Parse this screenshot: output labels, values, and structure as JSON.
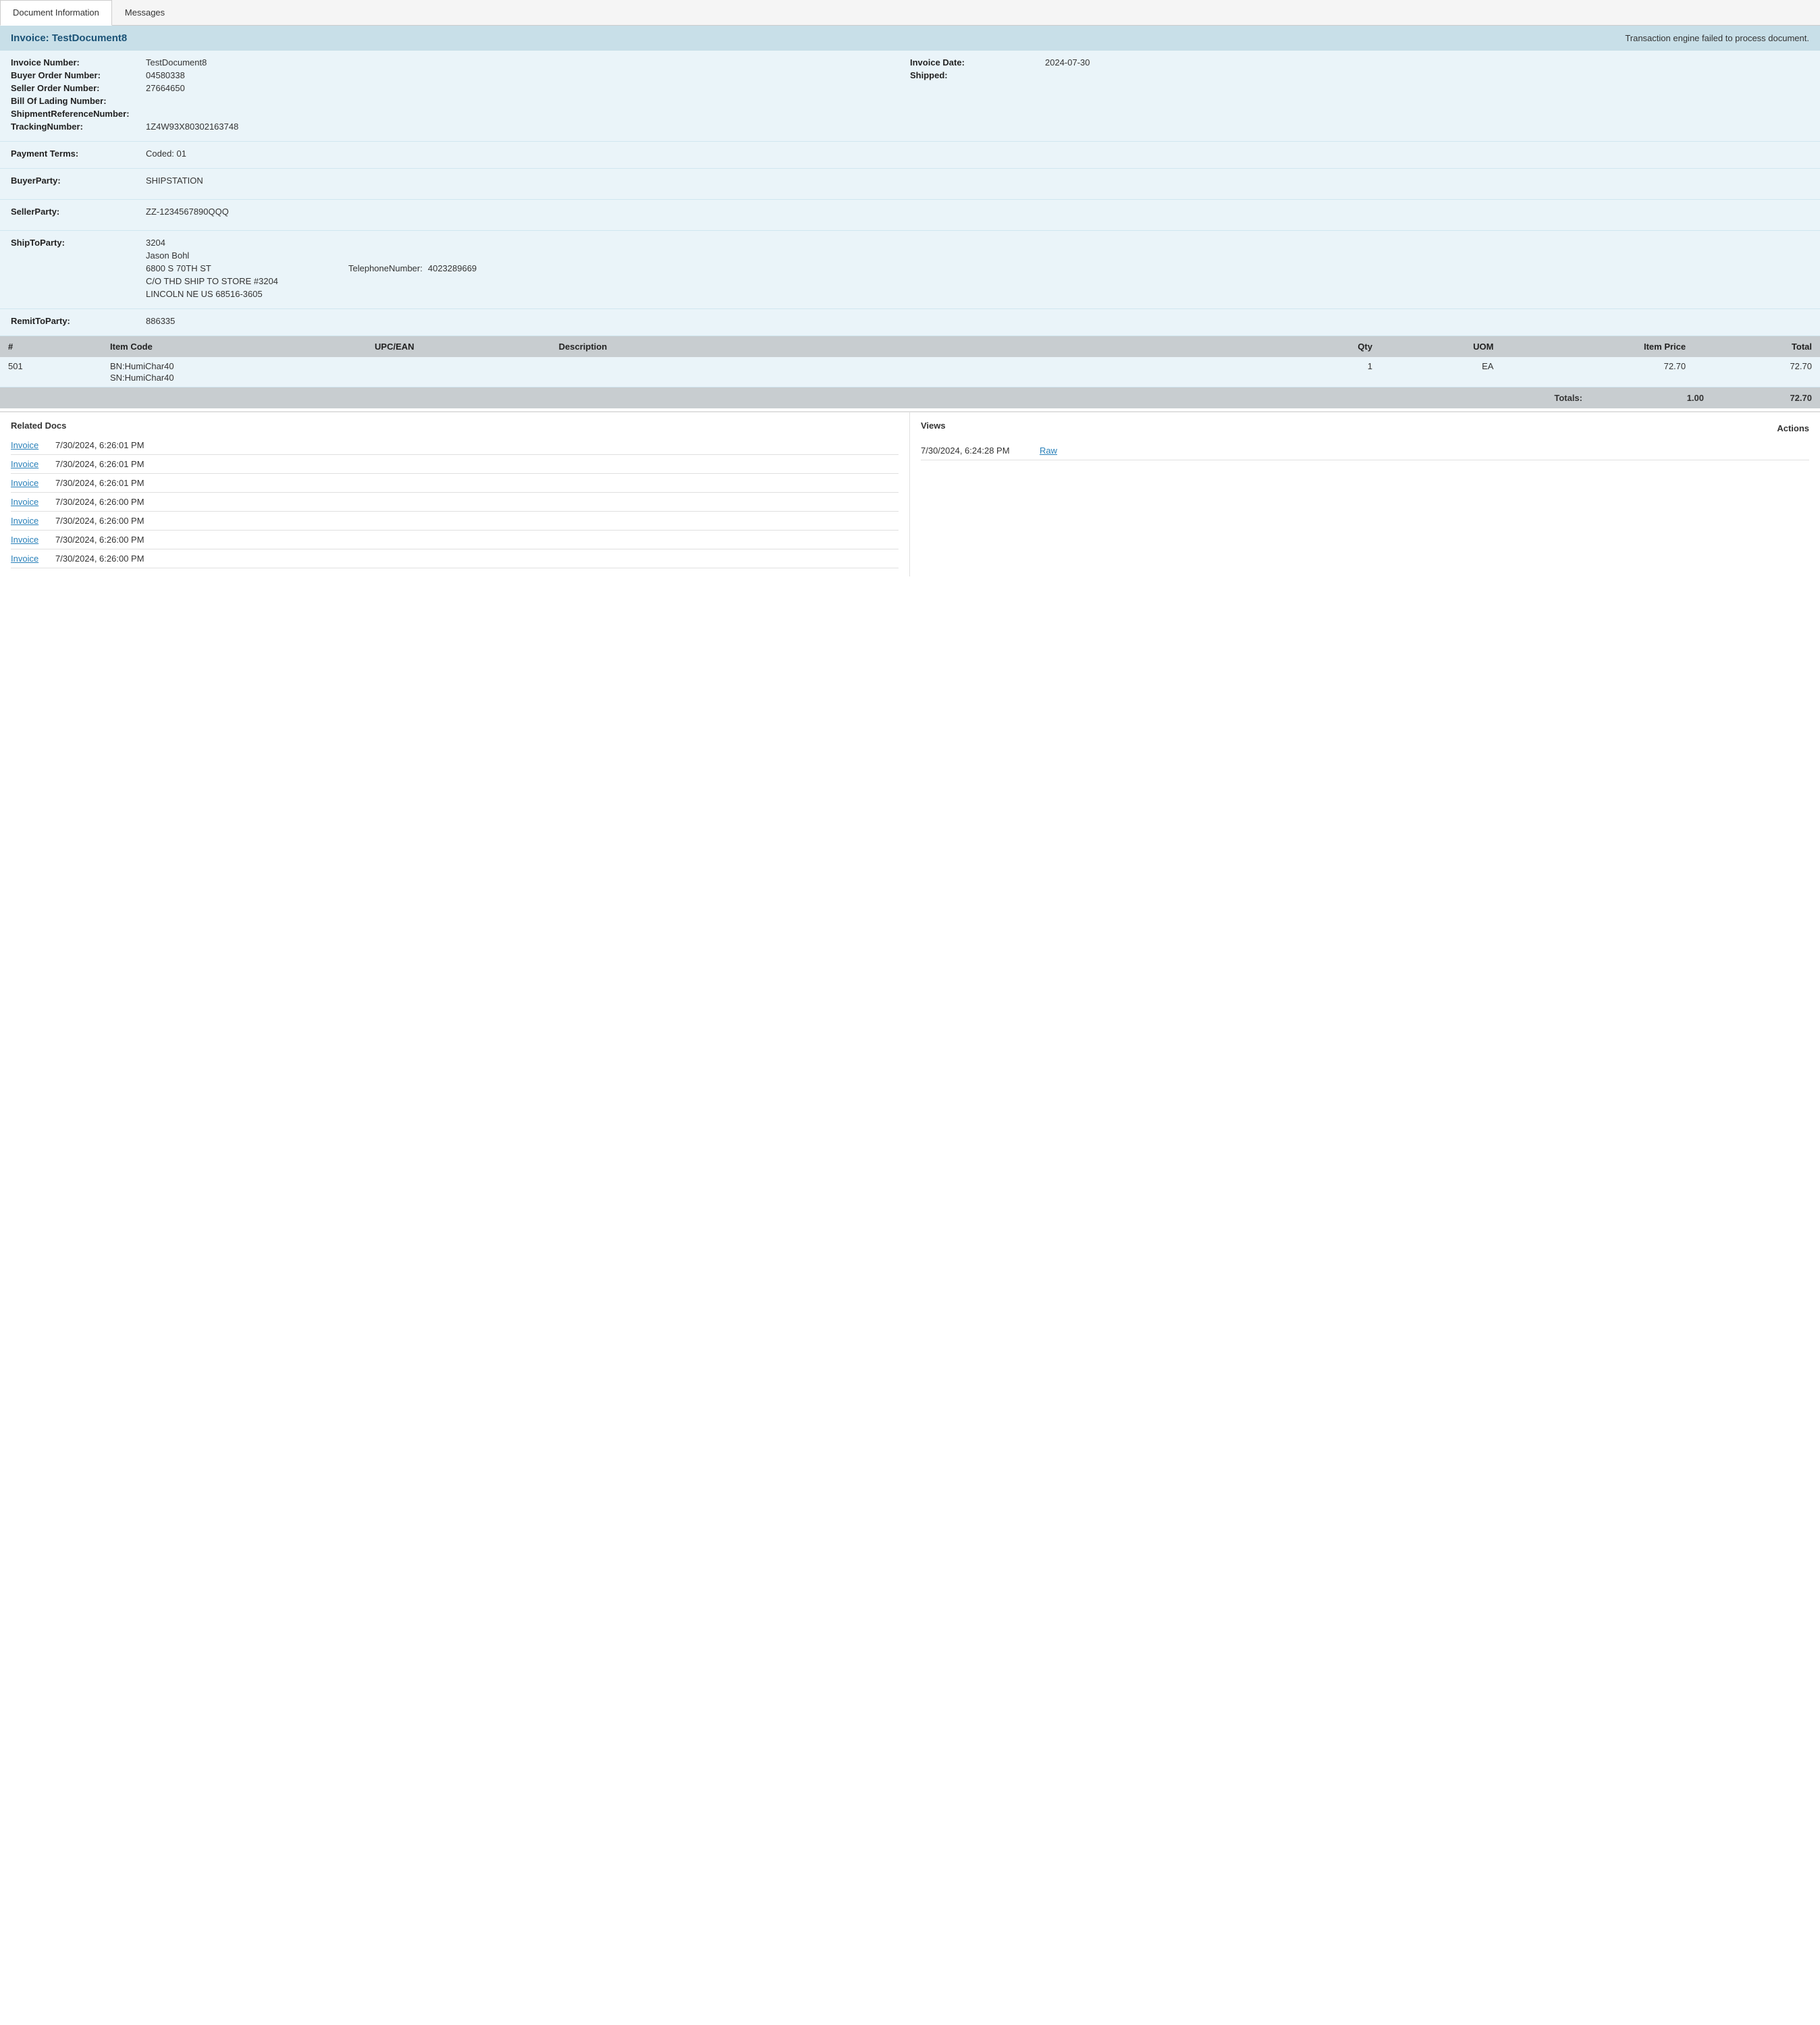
{
  "tabs": [
    {
      "id": "doc-info",
      "label": "Document Information",
      "active": true
    },
    {
      "id": "messages",
      "label": "Messages",
      "active": false
    }
  ],
  "banner": {
    "title": "Invoice: TestDocument8",
    "error": "Transaction engine failed to process document."
  },
  "fields": {
    "invoice_number_label": "Invoice Number:",
    "invoice_number_value": "TestDocument8",
    "invoice_date_label": "Invoice Date:",
    "invoice_date_value": "2024-07-30",
    "buyer_order_label": "Buyer Order Number:",
    "buyer_order_value": "04580338",
    "shipped_label": "Shipped:",
    "shipped_value": "",
    "seller_order_label": "Seller Order Number:",
    "seller_order_value": "27664650",
    "bill_of_lading_label": "Bill Of Lading Number:",
    "bill_of_lading_value": "",
    "shipment_ref_label": "ShipmentReferenceNumber:",
    "shipment_ref_value": "",
    "tracking_label": "TrackingNumber:",
    "tracking_value": "1Z4W93X80302163748",
    "payment_terms_label": "Payment Terms:",
    "payment_terms_value": "Coded: 01",
    "buyer_party_label": "BuyerParty:",
    "buyer_party_value": "SHIPSTATION",
    "seller_party_label": "SellerParty:",
    "seller_party_value": "ZZ-1234567890QQQ",
    "shipto_party_label": "ShipToParty:",
    "shipto_id": "3204",
    "shipto_name": "Jason Bohl",
    "shipto_address1": "6800 S 70TH ST",
    "shipto_phone_label": "TelephoneNumber:",
    "shipto_phone_value": "4023289669",
    "shipto_address2": "C/O THD SHIP TO STORE #3204",
    "shipto_city_state": "LINCOLN NE US 68516-3605",
    "remit_to_label": "RemitToParty:",
    "remit_to_value": "886335"
  },
  "table": {
    "headers": [
      {
        "id": "num",
        "label": "#"
      },
      {
        "id": "item_code",
        "label": "Item Code"
      },
      {
        "id": "upc",
        "label": "UPC/EAN"
      },
      {
        "id": "description",
        "label": "Description"
      },
      {
        "id": "qty",
        "label": "Qty",
        "align": "right"
      },
      {
        "id": "uom",
        "label": "UOM",
        "align": "right"
      },
      {
        "id": "item_price",
        "label": "Item Price",
        "align": "right"
      },
      {
        "id": "total",
        "label": "Total",
        "align": "right"
      }
    ],
    "rows": [
      {
        "num": "501",
        "item_code_line1": "BN:HumiChar40",
        "item_code_line2": "SN:HumiChar40",
        "upc": "",
        "description": "",
        "qty": "1",
        "uom": "EA",
        "item_price": "72.70",
        "total": "72.70"
      }
    ],
    "totals_label": "Totals:",
    "totals_qty": "1.00",
    "totals_total": "72.70"
  },
  "related_docs": {
    "header": "Related Docs",
    "items": [
      {
        "link": "Invoice",
        "date": "7/30/2024, 6:26:01 PM"
      },
      {
        "link": "Invoice",
        "date": "7/30/2024, 6:26:01 PM"
      },
      {
        "link": "Invoice",
        "date": "7/30/2024, 6:26:01 PM"
      },
      {
        "link": "Invoice",
        "date": "7/30/2024, 6:26:00 PM"
      },
      {
        "link": "Invoice",
        "date": "7/30/2024, 6:26:00 PM"
      },
      {
        "link": "Invoice",
        "date": "7/30/2024, 6:26:00 PM"
      },
      {
        "link": "Invoice",
        "date": "7/30/2024, 6:26:00 PM"
      }
    ]
  },
  "views": {
    "header": "Views",
    "actions_header": "Actions",
    "items": [
      {
        "date": "7/30/2024, 6:24:28 PM",
        "link": "Raw"
      }
    ]
  }
}
